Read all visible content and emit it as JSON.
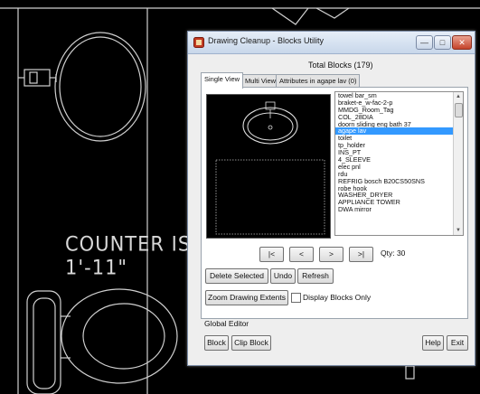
{
  "background": {
    "cad_text_line1": "COUNTER IS",
    "cad_text_line2": "1'-11\""
  },
  "window": {
    "title": "Drawing Cleanup - Blocks Utility",
    "buttons": {
      "minimize": "—",
      "maximize": "□",
      "close": "✕"
    }
  },
  "header": {
    "total_blocks": "Total Blocks (179)"
  },
  "tabs": [
    {
      "label": "Single View",
      "active": true
    },
    {
      "label": "Multi View",
      "active": false
    },
    {
      "label": "Attributes in agape lav (0)",
      "active": false
    }
  ],
  "blocks_list": {
    "selected_index": 5,
    "items": [
      "towel bar_sm",
      "braket-e_w-fac-2-p",
      "MMDG_Room_Tag",
      "COL_28DIA",
      "doorn sliding eng bath 37",
      "agape lav",
      "toilet",
      "tp_holder",
      "INS_PT",
      "4_SLEEVE",
      "elec pnl",
      "rdu",
      "REFRIG bosch B20CS50SNS",
      "robe hook",
      "WASHER_DRYER",
      "APPLIANCE TOWER",
      "DWA mirror"
    ]
  },
  "navigation": {
    "first": "|<",
    "prev": "<",
    "next": ">",
    "last": ">|",
    "qty": "Qty: 30"
  },
  "actions": {
    "delete_selected": "Delete Selected",
    "undo": "Undo",
    "refresh": "Refresh",
    "zoom_extents": "Zoom Drawing Extents",
    "display_blocks_only": "Display Blocks Only",
    "display_blocks_only_checked": false
  },
  "global_editor": {
    "label": "Global Editor",
    "block": "Block",
    "clip_block": "Clip Block",
    "help": "Help",
    "exit": "Exit"
  },
  "colors": {
    "selection": "#3399ff",
    "cad_background": "#000000",
    "cad_lines": "#d8d8d8"
  }
}
